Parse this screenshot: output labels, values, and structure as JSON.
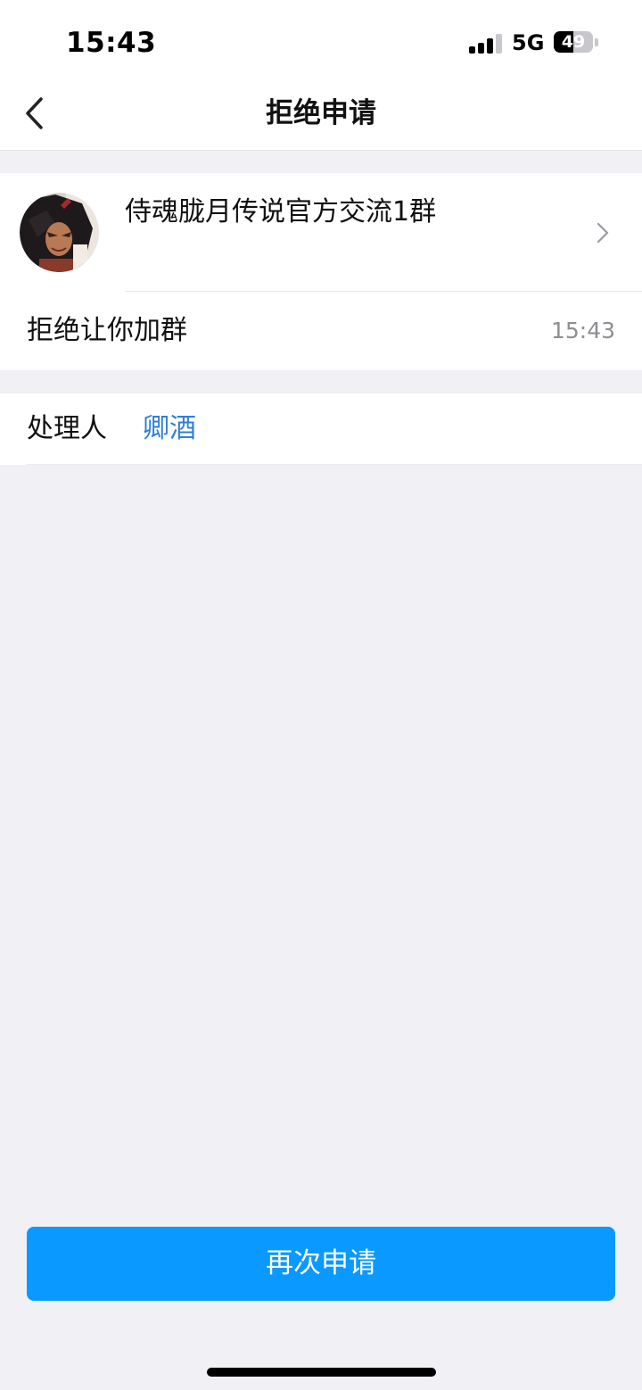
{
  "status_bar": {
    "time": "15:43",
    "network": "5G",
    "battery_level": "49"
  },
  "nav": {
    "title": "拒绝申请",
    "back_icon": "chevron-left-icon"
  },
  "group": {
    "name": "侍魂胧月传说官方交流1群",
    "avatar_icon": "group-avatar",
    "chevron_icon": "chevron-right-icon",
    "status_text": "拒绝让你加群",
    "timestamp": "15:43"
  },
  "handler": {
    "label": "处理人",
    "name": "卿酒"
  },
  "actions": {
    "reapply_label": "再次申请"
  },
  "colors": {
    "accent_blue": "#0a99ff",
    "link_blue": "#2f7fd6",
    "background": "#f0f0f5"
  }
}
